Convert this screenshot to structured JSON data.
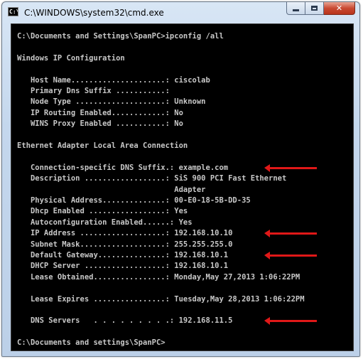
{
  "window": {
    "title": "C:\\WINDOWS\\system32\\cmd.exe",
    "icon_text": "C:\\",
    "icon": "command-prompt-icon",
    "controls": {
      "minimize": "minimize-icon",
      "maximize": "maximize-icon",
      "close": "✕"
    }
  },
  "console": {
    "lines": [
      "C:\\Documents and Settings\\SpanPC>ipconfig /all",
      "",
      "Windows IP Configuration",
      "",
      "   Host Name.....................: ciscolab",
      "   Primary Dns Suffix ...........:",
      "   Node Type ....................: Unknown",
      "   IP Routing Enabled............: No",
      "   WINS Proxy Enabled ...........: No",
      "",
      "Ethernet Adapter Local Area Connection",
      "",
      "   Connection-specific DNS Suffix.: example.com",
      "   Description ..................: SiS 900 PCI Fast Ethernet",
      "                                   Adapter",
      "   Physical Address..............: 00-E0-18-5B-DD-35",
      "   Dhcp Enabled .................: Yes",
      "   Autoconfiguration Enabled......: Yes",
      "   IP Address ...................: 192.168.10.10",
      "   Subnet Mask...................: 255.255.255.0",
      "   Default Gateway...............: 192.168.10.1",
      "   DHCP Server ..................: 192.168.10.1",
      "   Lease Obtained................: Monday,May 27,2013 1:06:22PM",
      "",
      "   Lease Expires ................: Tuesday,May 28,2013 1:06:22PM",
      "",
      "   DNS Servers   . . . . . . . . .: 192.168.11.5",
      "",
      "C:\\Documents and settings\\SpanPC>"
    ]
  },
  "annotations": [
    {
      "target": "Connection-specific DNS Suffix",
      "color": "#e01818"
    },
    {
      "target": "IP Address",
      "color": "#e01818"
    },
    {
      "target": "Default Gateway",
      "color": "#e01818"
    },
    {
      "target": "DNS Servers",
      "color": "#e01818"
    }
  ]
}
